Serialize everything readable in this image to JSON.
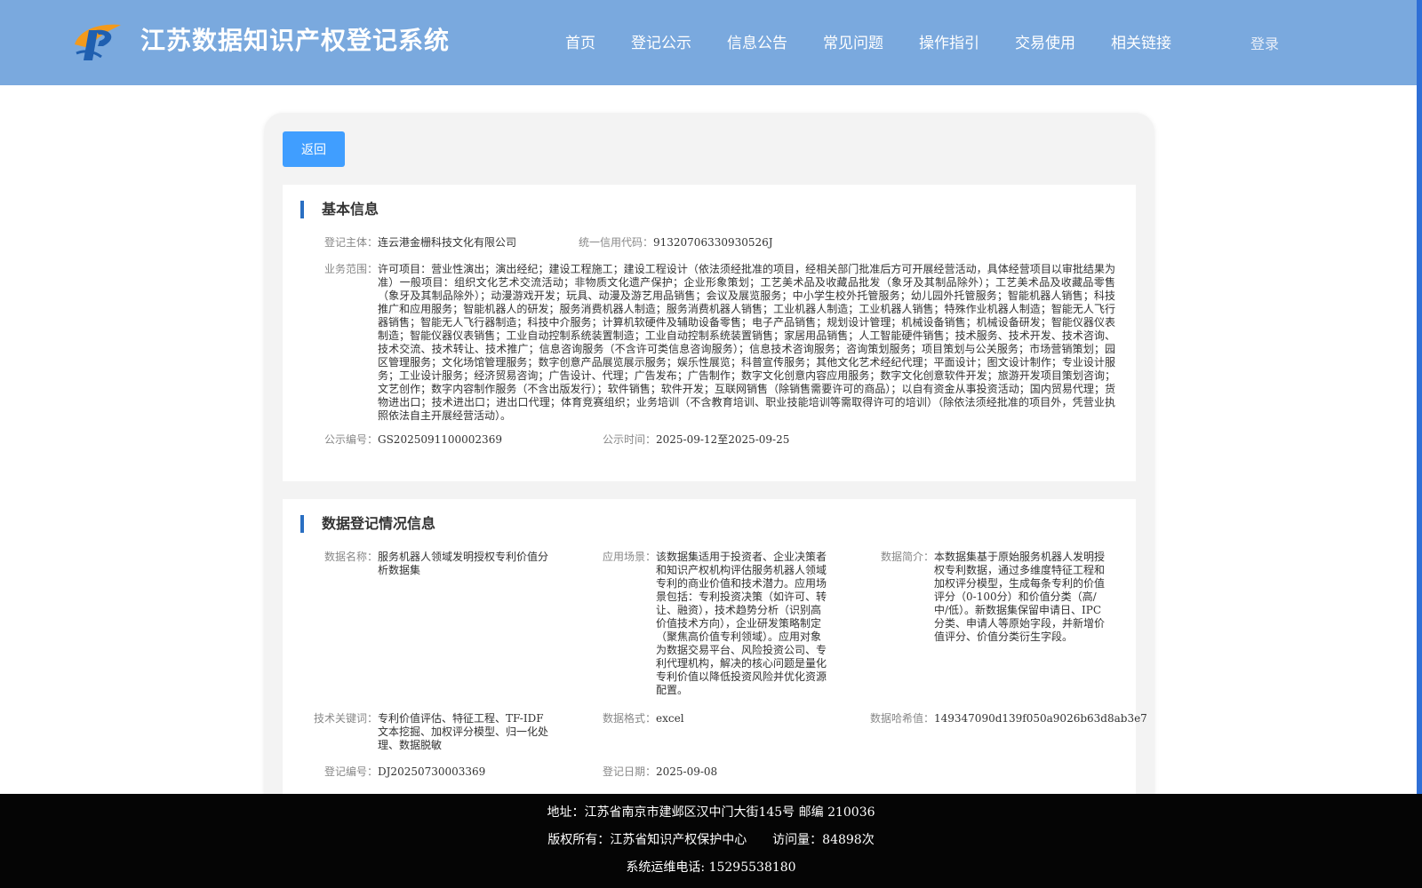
{
  "header": {
    "title": "江苏数据知识产权登记系统",
    "nav": [
      "首页",
      "登记公示",
      "信息公告",
      "常见问题",
      "操作指引",
      "交易使用",
      "相关链接"
    ],
    "login": "登录",
    "colors": {
      "header_bg": "#7aa9de",
      "accent": "#409eff"
    }
  },
  "back_button": "返回",
  "basic_info": {
    "title": "基本信息",
    "entity_label": "登记主体：",
    "entity_value": "连云港金栅科技文化有限公司",
    "credit_label": "统一信用代码：",
    "credit_value": "91320706330930526J",
    "scope_label": "业务范围：",
    "scope_value": "许可项目：营业性演出；演出经纪；建设工程施工；建设工程设计（依法须经批准的项目，经相关部门批准后方可开展经营活动，具体经营项目以审批结果为准）一般项目：组织文化艺术交流活动；非物质文化遗产保护；企业形象策划；工艺美术品及收藏品批发（象牙及其制品除外）；工艺美术品及收藏品零售（象牙及其制品除外）；动漫游戏开发；玩具、动漫及游艺用品销售；会议及展览服务；中小学生校外托管服务；幼儿园外托管服务；智能机器人销售；科技推广和应用服务；智能机器人的研发；服务消费机器人制造；服务消费机器人销售；工业机器人制造；工业机器人销售；特殊作业机器人制造；智能无人飞行器销售；智能无人飞行器制造；科技中介服务；计算机软硬件及辅助设备零售；电子产品销售；规划设计管理；机械设备销售；机械设备研发；智能仪器仪表制造；智能仪器仪表销售；工业自动控制系统装置制造；工业自动控制系统装置销售；家居用品销售；人工智能硬件销售；技术服务、技术开发、技术咨询、技术交流、技术转让、技术推广；信息咨询服务（不含许可类信息咨询服务）；信息技术咨询服务；咨询策划服务；项目策划与公关服务；市场营销策划；园区管理服务；文化场馆管理服务；数字创意产品展览展示服务；娱乐性展览；科普宣传服务；其他文化艺术经纪代理；平面设计；图文设计制作；专业设计服务；工业设计服务；经济贸易咨询；广告设计、代理；广告发布；广告制作；数字文化创意内容应用服务；数字文化创意软件开发；旅游开发项目策划咨询；文艺创作；数字内容制作服务（不含出版发行）；软件销售；软件开发；互联网销售（除销售需要许可的商品）；以自有资金从事投资活动；国内贸易代理；货物进出口；技术进出口；进出口代理；体育竞赛组织；业务培训（不含教育培训、职业技能培训等需取得许可的培训）（除依法须经批准的项目外，凭营业执照依法自主开展经营活动）。",
    "pub_no_label": "公示编号：",
    "pub_no_value": "GS2025091100002369",
    "pub_time_label": "公示时间：",
    "pub_time_value": "2025-09-12至2025-09-25"
  },
  "data_info": {
    "title": "数据登记情况信息",
    "name_label": "数据名称：",
    "name_value": "服务机器人领域发明授权专利价值分析数据集",
    "scene_label": "应用场景：",
    "scene_value": "该数据集适用于投资者、企业决策者和知识产权机构评估服务机器人领域专利的商业价值和技术潜力。应用场景包括：专利投资决策（如许可、转让、融资），技术趋势分析（识别高价值技术方向），企业研发策略制定（聚焦高价值专利领域）。应用对象为数据交易平台、风险投资公司、专利代理机构，解决的核心问题是量化专利价值以降低投资风险并优化资源配置。",
    "intro_label": "数据简介：",
    "intro_value": "本数据集基于原始服务机器人发明授权专利数据，通过多维度特征工程和加权评分模型，生成每条专利的价值评分（0-100分）和价值分类（高/中/低）。新数据集保留申请日、IPC分类、申请人等原始字段，并新增价值评分、价值分类衍生字段。",
    "keywords_label": "技术关键词：",
    "keywords_value": "专利价值评估、特征工程、TF-IDF文本挖掘、加权评分模型、归一化处理、数据脱敏",
    "format_label": "数据格式：",
    "format_value": "excel",
    "hash_label": "数据哈希值：",
    "hash_value": "149347090d139f050a9026b63d8ab3e7",
    "reg_no_label": "登记编号：",
    "reg_no_value": "DJ20250730003369",
    "reg_date_label": "登记日期：",
    "reg_date_value": "2025-09-08"
  },
  "footer": {
    "address": "地址：江苏省南京市建邺区汉中门大街145号 邮编 210036",
    "copyright": "版权所有：江苏省知识产权保护中心",
    "visits": "访问量：84898次",
    "phone": "系统运维电话: 15295538180"
  }
}
